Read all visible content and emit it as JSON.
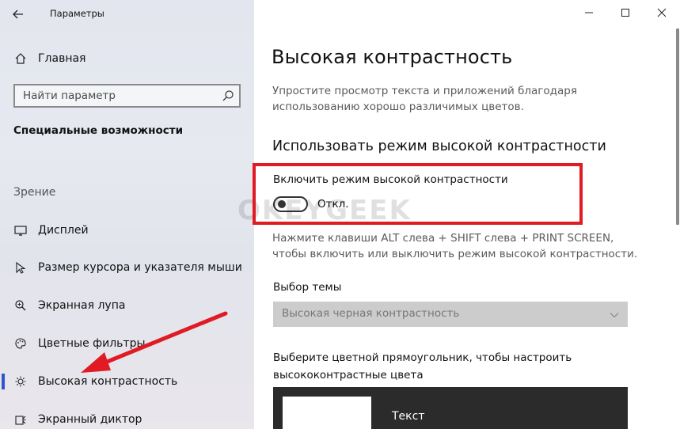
{
  "window": {
    "title": "Параметры"
  },
  "sidebar": {
    "home_label": "Главная",
    "search_placeholder": "Найти параметр",
    "section_title": "Специальные возможности",
    "group_title": "Зрение",
    "items": [
      {
        "label": "Дисплей",
        "icon": "display-icon"
      },
      {
        "label": "Размер курсора и указателя мыши",
        "icon": "cursor-icon"
      },
      {
        "label": "Экранная лупа",
        "icon": "magnifier-icon"
      },
      {
        "label": "Цветные фильтры",
        "icon": "palette-icon"
      },
      {
        "label": "Высокая контрастность",
        "icon": "brightness-icon",
        "selected": true
      },
      {
        "label": "Экранный диктор",
        "icon": "narrator-icon"
      }
    ]
  },
  "main": {
    "title": "Высокая контрастность",
    "description": "Упростите просмотр текста и приложений благодаря использованию хорошо различимых цветов.",
    "section_heading": "Использовать режим высокой контрастности",
    "toggle_label": "Включить режим высокой контрастности",
    "toggle_state": "Откл.",
    "toggle_on": false,
    "hint": "Нажмите клавиши ALT слева + SHIFT слева + PRINT SCREEN, чтобы включить или выключить режим высокой контрастности.",
    "theme_label": "Выбор темы",
    "theme_value": "Высокая черная контрастность",
    "rect_label": "Выберите цветной прямоугольник, чтобы настроить высококонтрастные цвета",
    "preview_text": "Текст"
  },
  "watermark": "OKEYGEEK",
  "colors": {
    "accent": "#2f57c9",
    "annotation": "#e01b24",
    "sidebar_bg": "#e4e7ee",
    "preview_bg": "#2b2b2b",
    "select_bg": "#cccccc"
  }
}
